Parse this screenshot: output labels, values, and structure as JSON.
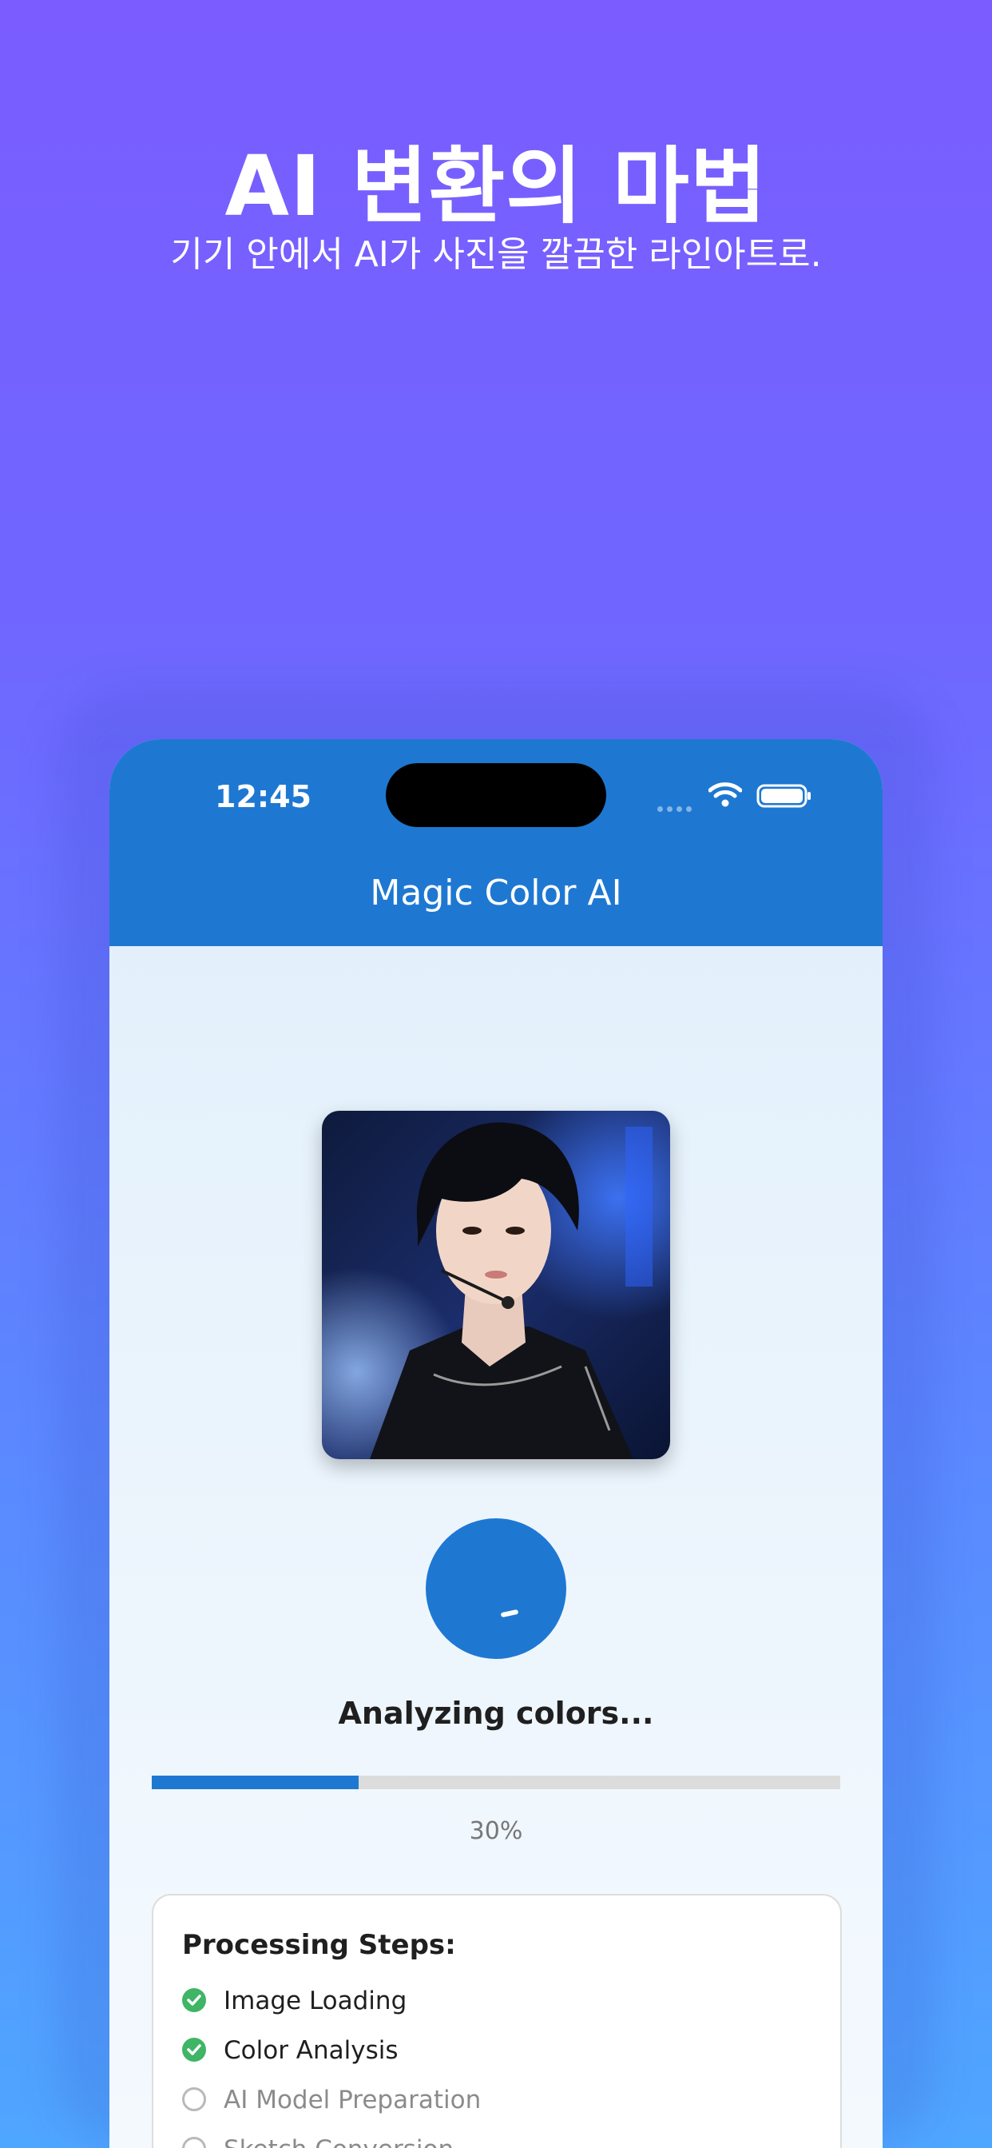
{
  "promo": {
    "title": "AI 변환의 마법",
    "subtitle": "기기 안에서 AI가 사진을 깔끔한 라인아트로."
  },
  "status_bar": {
    "time": "12:45"
  },
  "app": {
    "title": "Magic Color AI"
  },
  "processing": {
    "status_text": "Analyzing colors...",
    "progress_percent": 30,
    "progress_label": "30%"
  },
  "steps": {
    "title": "Processing Steps:",
    "items": [
      {
        "label": "Image Loading",
        "state": "done"
      },
      {
        "label": "Color Analysis",
        "state": "done"
      },
      {
        "label": "AI Model Preparation",
        "state": "pending"
      },
      {
        "label": "Sketch Conversion",
        "state": "pending"
      }
    ]
  },
  "colors": {
    "brand": "#1e78d2",
    "success": "#3fb565"
  }
}
